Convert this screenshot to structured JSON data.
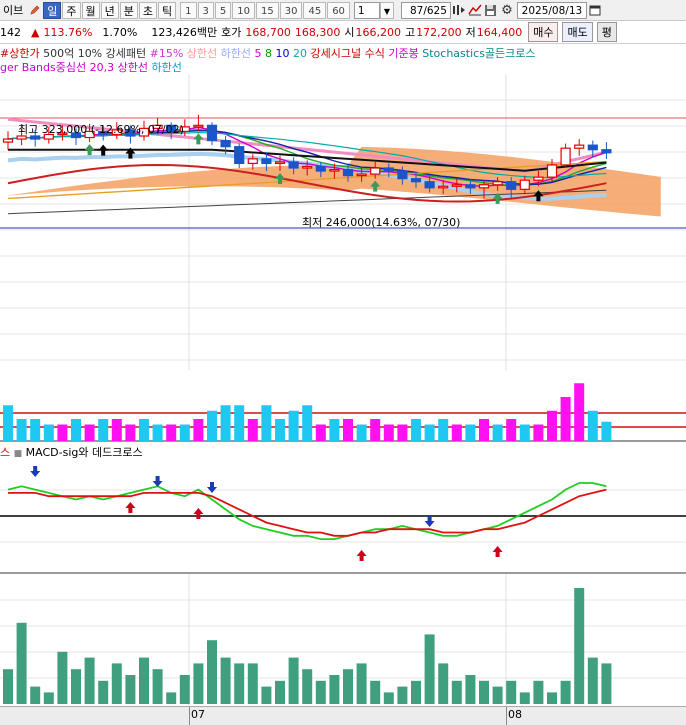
{
  "toolbar": {
    "left_label": "이브",
    "period_buttons": [
      "일",
      "주",
      "월",
      "년",
      "분",
      "초",
      "틱"
    ],
    "active_period": "일",
    "interval_buttons": [
      "1",
      "3",
      "5",
      "10",
      "15",
      "30",
      "45",
      "60"
    ],
    "count_value": "1",
    "page_counter": "87/625",
    "date": "2025/08/13"
  },
  "quote": {
    "price_partial": "142",
    "change_pct": "113.76%",
    "change2": "1.70%",
    "volume": "123,426백만",
    "hoga_label": "호가",
    "ask": "168,700",
    "bid": "168,300",
    "open_label": "시",
    "open": "166,200",
    "high_label": "고",
    "high": "172,200",
    "low_label": "저",
    "low": "164,400",
    "buy_button": "매수",
    "sell_button": "매도",
    "eval_button": "평"
  },
  "legend1": {
    "items": [
      {
        "text": "#상한가",
        "color": "#cc0000"
      },
      {
        "text": "500억 10% 강세패턴",
        "color": "#333333"
      },
      {
        "text": "#15%",
        "color": "#cc33cc"
      },
      {
        "text": "상한선",
        "color": "#ff9999"
      },
      {
        "text": "하한선",
        "color": "#99aaff"
      },
      {
        "text": "5",
        "color": "#cc00cc"
      },
      {
        "text": "8",
        "color": "#009900"
      },
      {
        "text": "10",
        "color": "#0000cc"
      },
      {
        "text": "20",
        "color": "#00aaaa"
      },
      {
        "text": "강세시그널 수식",
        "color": "#cc0000"
      },
      {
        "text": "기준봉",
        "color": "#cc00cc"
      },
      {
        "text": "Stochastics골든크로스",
        "color": "#008888"
      }
    ]
  },
  "legend2": {
    "items": [
      {
        "text": "ger Bands중심선 20,3",
        "color": "#cc00cc"
      },
      {
        "text": "상한선",
        "color": "#cc00cc"
      },
      {
        "text": "하한선",
        "color": "#0099cc"
      }
    ]
  },
  "annotations": {
    "high": "최고 323,000 (-12.69%, 07/02)",
    "low": "최저 246,000(14.63%, 07/30)"
  },
  "macd_legend": {
    "prefix": "스",
    "label": "MACD-sig와 데드크로스"
  },
  "axis": {
    "month_labels": [
      "07",
      "08"
    ]
  },
  "colors": {
    "bull_candle": "#e00000",
    "bear_candle": "#1a56c8",
    "bar_cyan": "#1ec8f0",
    "bar_magenta": "#ff10f0",
    "volume": "#3f9f7f",
    "cloud": "#f4a060"
  },
  "chart_data": {
    "type": "candlestick",
    "candles": [
      {
        "o": 305,
        "c": 307,
        "h": 312,
        "l": 300
      },
      {
        "o": 307,
        "c": 309,
        "h": 314,
        "l": 303
      },
      {
        "o": 309,
        "c": 307,
        "h": 313,
        "l": 302
      },
      {
        "o": 307,
        "c": 310,
        "h": 315,
        "l": 304
      },
      {
        "o": 310,
        "c": 311,
        "h": 316,
        "l": 306
      },
      {
        "o": 311,
        "c": 308,
        "h": 314,
        "l": 303
      },
      {
        "o": 308,
        "c": 312,
        "h": 317,
        "l": 305
      },
      {
        "o": 312,
        "c": 310,
        "h": 316,
        "l": 306
      },
      {
        "o": 310,
        "c": 313,
        "h": 318,
        "l": 307
      },
      {
        "o": 313,
        "c": 309,
        "h": 316,
        "l": 304
      },
      {
        "o": 309,
        "c": 314,
        "h": 319,
        "l": 306
      },
      {
        "o": 314,
        "c": 316,
        "h": 321,
        "l": 310
      },
      {
        "o": 316,
        "c": 312,
        "h": 318,
        "l": 307
      },
      {
        "o": 312,
        "c": 315,
        "h": 320,
        "l": 309
      },
      {
        "o": 315,
        "c": 316,
        "h": 323,
        "l": 312
      },
      {
        "o": 316,
        "c": 306,
        "h": 318,
        "l": 303
      },
      {
        "o": 306,
        "c": 302,
        "h": 309,
        "l": 297
      },
      {
        "o": 302,
        "c": 291,
        "h": 304,
        "l": 288
      },
      {
        "o": 291,
        "c": 294,
        "h": 297,
        "l": 287
      },
      {
        "o": 294,
        "c": 291,
        "h": 298,
        "l": 286
      },
      {
        "o": 291,
        "c": 292,
        "h": 296,
        "l": 286
      },
      {
        "o": 292,
        "c": 288,
        "h": 295,
        "l": 284
      },
      {
        "o": 288,
        "c": 289,
        "h": 293,
        "l": 283
      },
      {
        "o": 289,
        "c": 286,
        "h": 292,
        "l": 282
      },
      {
        "o": 286,
        "c": 287,
        "h": 291,
        "l": 281
      },
      {
        "o": 287,
        "c": 283,
        "h": 290,
        "l": 279
      },
      {
        "o": 283,
        "c": 284,
        "h": 288,
        "l": 279
      },
      {
        "o": 284,
        "c": 288,
        "h": 292,
        "l": 281
      },
      {
        "o": 288,
        "c": 286,
        "h": 291,
        "l": 282
      },
      {
        "o": 286,
        "c": 281,
        "h": 289,
        "l": 277
      },
      {
        "o": 281,
        "c": 279,
        "h": 285,
        "l": 275
      },
      {
        "o": 279,
        "c": 275,
        "h": 283,
        "l": 272
      },
      {
        "o": 275,
        "c": 276,
        "h": 280,
        "l": 271
      },
      {
        "o": 276,
        "c": 277,
        "h": 281,
        "l": 272
      },
      {
        "o": 277,
        "c": 275,
        "h": 281,
        "l": 271
      },
      {
        "o": 275,
        "c": 277,
        "h": 280,
        "l": 268
      },
      {
        "o": 277,
        "c": 279,
        "h": 282,
        "l": 273
      },
      {
        "o": 279,
        "c": 274,
        "h": 282,
        "l": 268
      },
      {
        "o": 274,
        "c": 280,
        "h": 283,
        "l": 271
      },
      {
        "o": 280,
        "c": 282,
        "h": 286,
        "l": 276
      },
      {
        "o": 282,
        "c": 290,
        "h": 294,
        "l": 279
      },
      {
        "o": 290,
        "c": 301,
        "h": 304,
        "l": 288
      },
      {
        "o": 301,
        "c": 303,
        "h": 307,
        "l": 296
      },
      {
        "o": 303,
        "c": 300,
        "h": 306,
        "l": 295
      },
      {
        "o": 300,
        "c": 298,
        "h": 305,
        "l": 294
      }
    ],
    "macd": [
      8,
      9,
      8,
      7,
      6,
      5,
      6,
      5,
      6,
      7,
      8,
      9,
      7,
      6,
      8,
      5,
      2,
      -1,
      -3,
      -4,
      -5,
      -6,
      -6,
      -7,
      -7,
      -6,
      -5,
      -4,
      -4,
      -3,
      -4,
      -5,
      -6,
      -6,
      -5,
      -4,
      -3,
      -1,
      1,
      3,
      5,
      8,
      10,
      10,
      9
    ],
    "signal": [
      7,
      7,
      7,
      6,
      6,
      6,
      6,
      6,
      6,
      6,
      7,
      7,
      7,
      7,
      7,
      6,
      4,
      2,
      0,
      -2,
      -3,
      -4,
      -5,
      -5,
      -6,
      -6,
      -5,
      -5,
      -4,
      -4,
      -4,
      -4,
      -5,
      -5,
      -5,
      -4,
      -4,
      -3,
      -2,
      0,
      2,
      4,
      6,
      7,
      8
    ],
    "mid_bars": [
      13,
      8,
      8,
      6,
      6,
      8,
      6,
      8,
      8,
      6,
      8,
      6,
      6,
      6,
      8,
      11,
      13,
      13,
      8,
      13,
      8,
      11,
      13,
      6,
      8,
      8,
      6,
      8,
      6,
      6,
      8,
      6,
      8,
      6,
      6,
      8,
      6,
      8,
      6,
      6,
      11,
      16,
      21,
      11,
      7
    ],
    "mid_bar_colors": [
      "c",
      "c",
      "c",
      "c",
      "m",
      "c",
      "m",
      "c",
      "m",
      "m",
      "c",
      "c",
      "m",
      "c",
      "m",
      "c",
      "c",
      "c",
      "m",
      "c",
      "c",
      "c",
      "c",
      "m",
      "c",
      "m",
      "c",
      "m",
      "m",
      "m",
      "c",
      "c",
      "c",
      "m",
      "c",
      "m",
      "c",
      "m",
      "c",
      "m",
      "m",
      "m",
      "m",
      "c",
      "c"
    ],
    "volume": [
      30,
      70,
      15,
      10,
      45,
      30,
      40,
      20,
      35,
      25,
      40,
      30,
      10,
      25,
      35,
      55,
      40,
      35,
      35,
      15,
      20,
      40,
      30,
      20,
      25,
      30,
      35,
      20,
      10,
      15,
      20,
      60,
      35,
      20,
      25,
      20,
      15,
      20,
      10,
      20,
      10,
      20,
      100,
      40,
      35
    ]
  }
}
